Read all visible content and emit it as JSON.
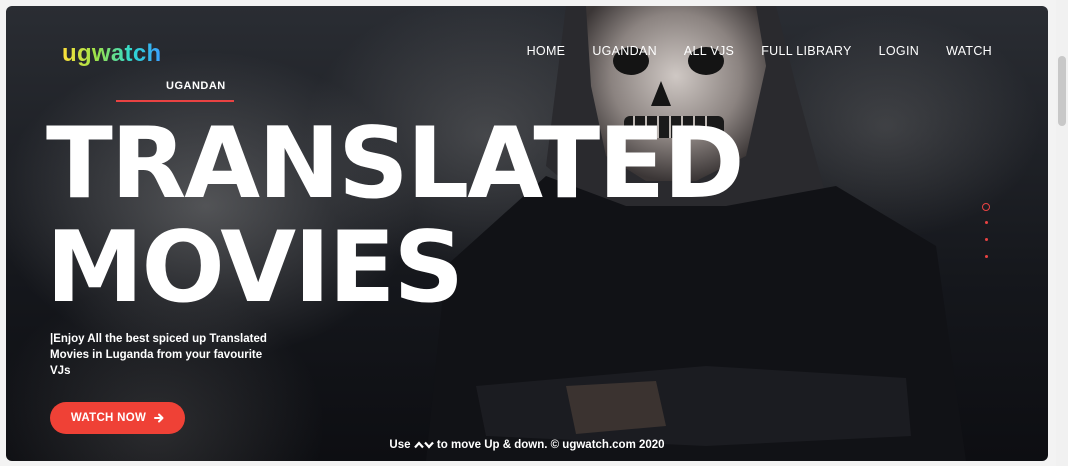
{
  "brand": {
    "logo": "ugwatch"
  },
  "nav": {
    "items": [
      {
        "label": "HOME"
      },
      {
        "label": "UGANDAN"
      },
      {
        "label": "ALL VJS"
      },
      {
        "label": "FULL LIBRARY"
      },
      {
        "label": "LOGIN"
      },
      {
        "label": "WATCH"
      }
    ]
  },
  "hero": {
    "tag": "UGANDAN",
    "headline_line1": "TRANSLATED",
    "headline_line2": "MOVIES",
    "description": "|Enjoy All the best spiced up Translated Movies in Luganda from your favourite VJs",
    "cta_label": "WATCH NOW",
    "cta_icon": "arrow-right-icon"
  },
  "footer": {
    "prefix": "Use",
    "suffix": "to move Up & down. © ugwatch.com 2020",
    "icons": [
      "chevron-up-icon",
      "chevron-down-icon"
    ]
  },
  "pager": {
    "count": 4,
    "active_index": 0
  },
  "colors": {
    "accent": "#ef4136",
    "underline": "#e94242",
    "background": "#15171c"
  }
}
